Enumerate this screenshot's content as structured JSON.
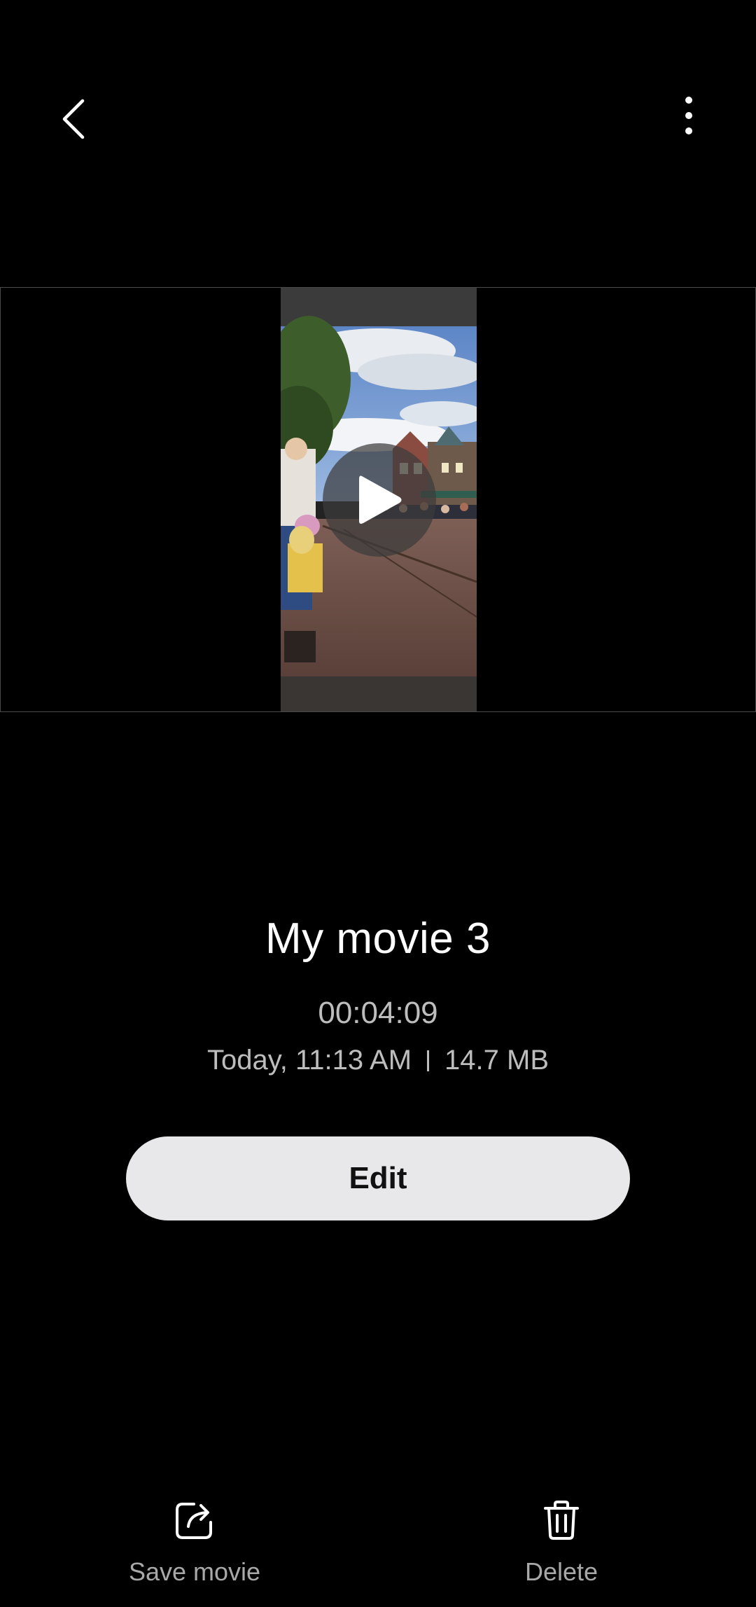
{
  "top_bar": {
    "back_icon": "chevron-left-icon",
    "more_icon": "more-vertical-icon"
  },
  "preview": {
    "play_icon": "play-icon"
  },
  "movie": {
    "title": "My movie 3",
    "duration": "00:04:09",
    "date": "Today, 11:13 AM",
    "size": "14.7 MB"
  },
  "edit_button": {
    "label": "Edit"
  },
  "bottom_actions": [
    {
      "label": "Save movie",
      "icon": "share-export-icon"
    },
    {
      "label": "Delete",
      "icon": "trash-icon"
    }
  ],
  "colors": {
    "background": "#000000",
    "edit_button_bg": "#e8e8ea",
    "secondary_text": "#bdbdbd",
    "action_label": "#a8a8a8"
  }
}
